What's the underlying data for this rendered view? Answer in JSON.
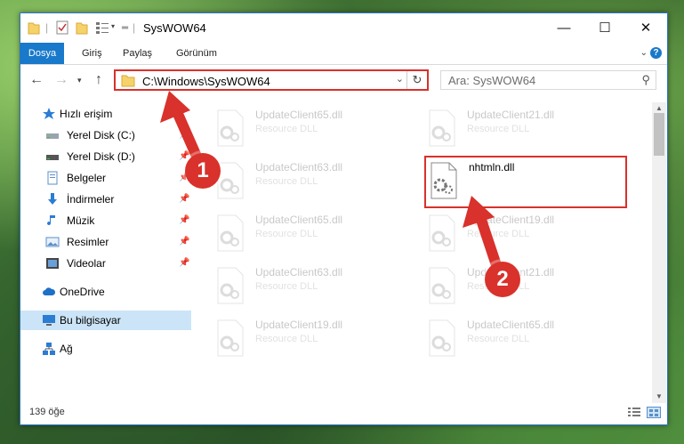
{
  "window": {
    "title": "SysWOW64",
    "controls": {
      "minimize": "—",
      "maximize": "☐",
      "close": "✕"
    }
  },
  "ribbon": {
    "tabs": [
      "Dosya",
      "Giriş",
      "Paylaş",
      "Görünüm"
    ]
  },
  "address": {
    "path": "C:\\Windows\\SysWOW64",
    "search_placeholder": "Ara: SysWOW64"
  },
  "navigation": {
    "items": [
      {
        "label": "Hızlı erişim",
        "icon": "star-icon"
      },
      {
        "label": "Yerel Disk (C:)",
        "icon": "drive-icon",
        "pinned": true
      },
      {
        "label": "Yerel Disk (D:)",
        "icon": "drive-icon",
        "pinned": true
      },
      {
        "label": "Belgeler",
        "icon": "documents-icon",
        "pinned": true
      },
      {
        "label": "İndirmeler",
        "icon": "download-icon",
        "pinned": true
      },
      {
        "label": "Müzik",
        "icon": "music-icon",
        "pinned": true
      },
      {
        "label": "Resimler",
        "icon": "pictures-icon",
        "pinned": true
      },
      {
        "label": "Videolar",
        "icon": "videos-icon",
        "pinned": true
      },
      {
        "label": "OneDrive",
        "icon": "cloud-icon"
      },
      {
        "label": "Bu bilgisayar",
        "icon": "computer-icon",
        "selected": true
      },
      {
        "label": "Ağ",
        "icon": "network-icon"
      }
    ]
  },
  "files": [
    {
      "name": "UpdateClient65.dll",
      "type": "Resource DLL"
    },
    {
      "name": "UpdateClient21.dll",
      "type": "Resource DLL"
    },
    {
      "name": "UpdateClient63.dll",
      "type": "Resource DLL"
    },
    {
      "name": "nhtmln.dll",
      "type": ""
    },
    {
      "name": "UpdateClient65.dll",
      "type": "Resource DLL"
    },
    {
      "name": "UpdateClient19.dll",
      "type": "Resource DLL"
    },
    {
      "name": "UpdateClient63.dll",
      "type": "Resource DLL"
    },
    {
      "name": "UpdateClient21.dll",
      "type": "Resource DLL"
    },
    {
      "name": "UpdateClient19.dll",
      "type": "Resource DLL"
    },
    {
      "name": "UpdateClient65.dll",
      "type": "Resource DLL"
    }
  ],
  "status": {
    "item_count": "139 öğe"
  },
  "annotations": {
    "step1": "1",
    "step2": "2",
    "accent": "#d9312b"
  }
}
